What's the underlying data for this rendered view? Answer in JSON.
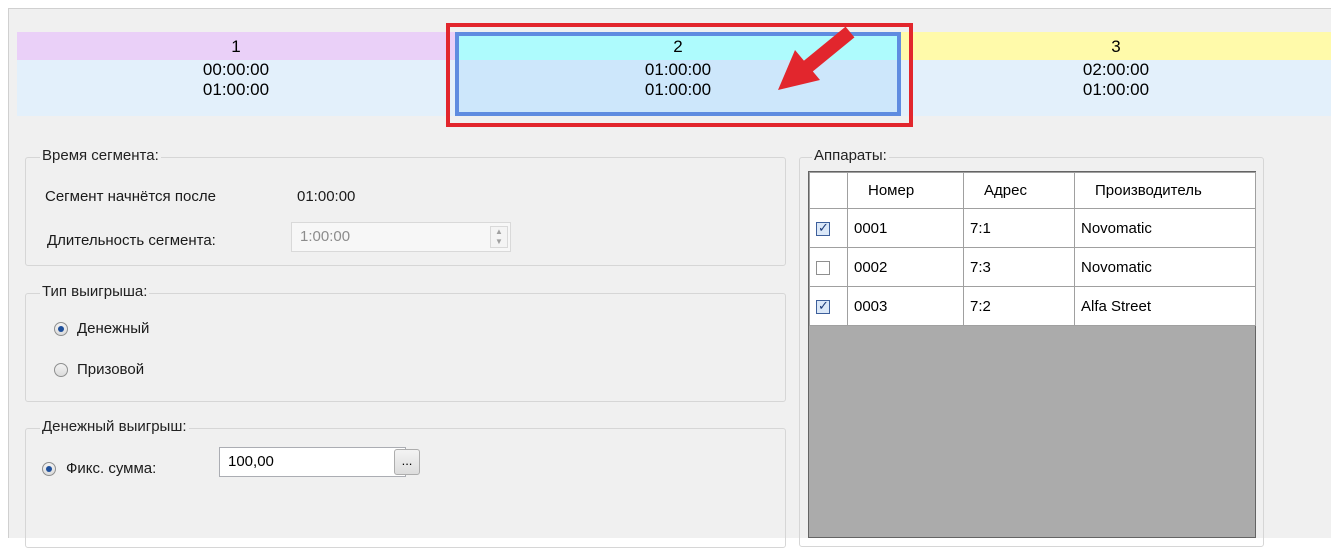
{
  "timeline": {
    "segments": [
      {
        "number": "1",
        "start": "00:00:00",
        "duration": "01:00:00",
        "color": "#ead0f8"
      },
      {
        "number": "2",
        "start": "01:00:00",
        "duration": "01:00:00",
        "color": "#aefbfd",
        "selected": true
      },
      {
        "number": "3",
        "start": "02:00:00",
        "duration": "01:00:00",
        "color": "#fffaaa"
      }
    ]
  },
  "segment_time": {
    "title": "Время сегмента:",
    "start_label": "Сегмент начнётся после",
    "start_value": "01:00:00",
    "duration_label": "Длительность сегмента:",
    "duration_value": "1:00:00"
  },
  "win_type": {
    "title": "Тип выигрыша:",
    "options": [
      {
        "label": "Денежный",
        "checked": true
      },
      {
        "label": "Призовой",
        "checked": false
      }
    ]
  },
  "money_win": {
    "title": "Денежный выигрыш:",
    "fixed_label": "Фикс. сумма:",
    "fixed_value": "100,00",
    "browse_label": "..."
  },
  "devices": {
    "title": "Аппараты:",
    "columns": [
      "Номер",
      "Адрес",
      "Производитель"
    ],
    "rows": [
      {
        "checked": true,
        "number": "0001",
        "address": "7:1",
        "manufacturer": "Novomatic"
      },
      {
        "checked": false,
        "number": "0002",
        "address": "7:3",
        "manufacturer": "Novomatic"
      },
      {
        "checked": true,
        "number": "0003",
        "address": "7:2",
        "manufacturer": "Alfa Street"
      }
    ]
  },
  "annotation_colors": {
    "highlight": "#e2262d",
    "arrow": "#e2262d"
  }
}
